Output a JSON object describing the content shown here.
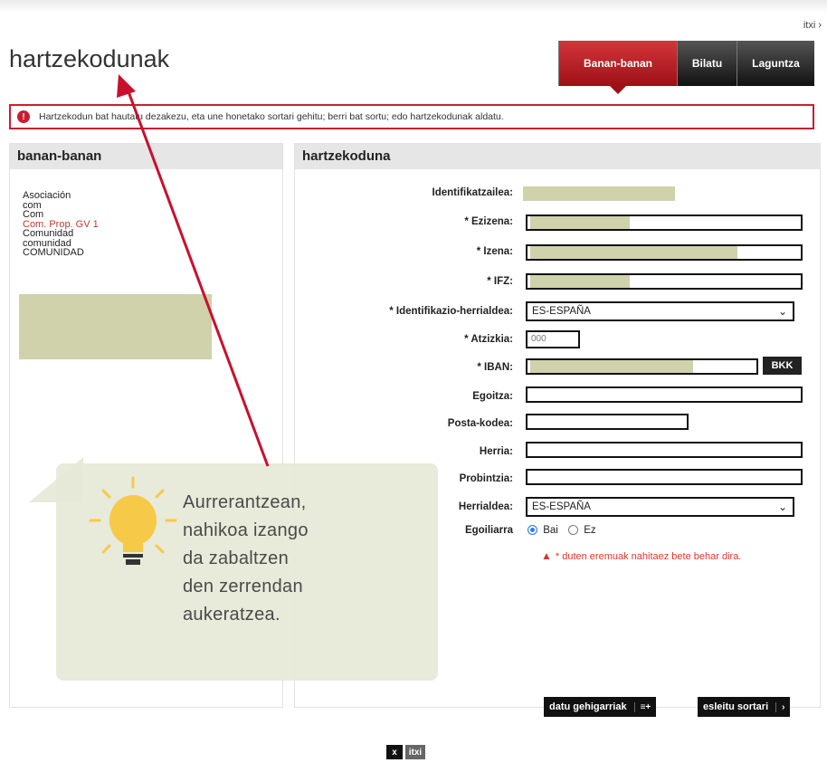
{
  "header": {
    "top_link": "itxi ›",
    "page_title": "hartzekodunak",
    "tabs": [
      {
        "label": "Banan-banan",
        "active": true
      },
      {
        "label": "Bilatu",
        "active": false
      },
      {
        "label": "Laguntza",
        "active": false
      }
    ]
  },
  "info_bar": {
    "icon": "alert-icon",
    "text": "Hartzekodun bat hautatu dezakezu, eta une honetako sortari gehitu; berri bat sortu; edo hartzekodunak aldatu."
  },
  "left_panel": {
    "title": "banan-banan",
    "items": [
      {
        "label": "Asociación",
        "highlight": false
      },
      {
        "label": "com",
        "highlight": false
      },
      {
        "label": "Com",
        "highlight": false
      },
      {
        "label": "Com. Prop. GV 1",
        "highlight": true
      },
      {
        "label": "Comunidad",
        "highlight": false
      },
      {
        "label": "comunidad",
        "highlight": false
      },
      {
        "label": "COMUNIDAD",
        "highlight": false
      }
    ]
  },
  "form": {
    "title": "hartzekoduna",
    "labels": {
      "identifikatzailea": "Identifikatzailea:",
      "ezizena": "* Ezizena:",
      "izena": "* Izena:",
      "ifz": "* IFZ:",
      "herrialdea_id": "* Identifikazio-herrialdea:",
      "atzizkia": "* Atzizkia:",
      "iban": "* IBAN:",
      "egoitza": "Egoitza:",
      "posta": "Posta-kodea:",
      "herria": "Herria:",
      "probintzia": "Probintzia:",
      "herrialdea": "Herrialdea:",
      "egoiliarra": "Egoiliarra"
    },
    "values": {
      "herrialdea_id": "ES-ESPAÑA",
      "atzizkia": "000",
      "herrialdea": "ES-ESPAÑA"
    },
    "bkk_label": "BKK",
    "radio_bai": "Bai",
    "radio_ez": "Ez",
    "warning": "* duten eremuak nahitaez bete behar dira.",
    "btn_extra": "datu gehigarriak",
    "btn_extra_icon": "≡+",
    "btn_assign": "esleitu sortari",
    "btn_assign_icon": "›"
  },
  "callout": {
    "lines": [
      "Aurrerantzean,",
      "nahikoa izango",
      "da zabaltzen",
      "den zerrendan",
      "aukeratzea."
    ],
    "icon": "lightbulb-icon"
  },
  "footer": {
    "close_label": "x",
    "itxi_label": "itxi"
  },
  "colors": {
    "accent_red": "#c81e32",
    "tab_dark": "#111111",
    "redacted": "#cfd2ab",
    "bulb_yellow": "#f7c948"
  }
}
